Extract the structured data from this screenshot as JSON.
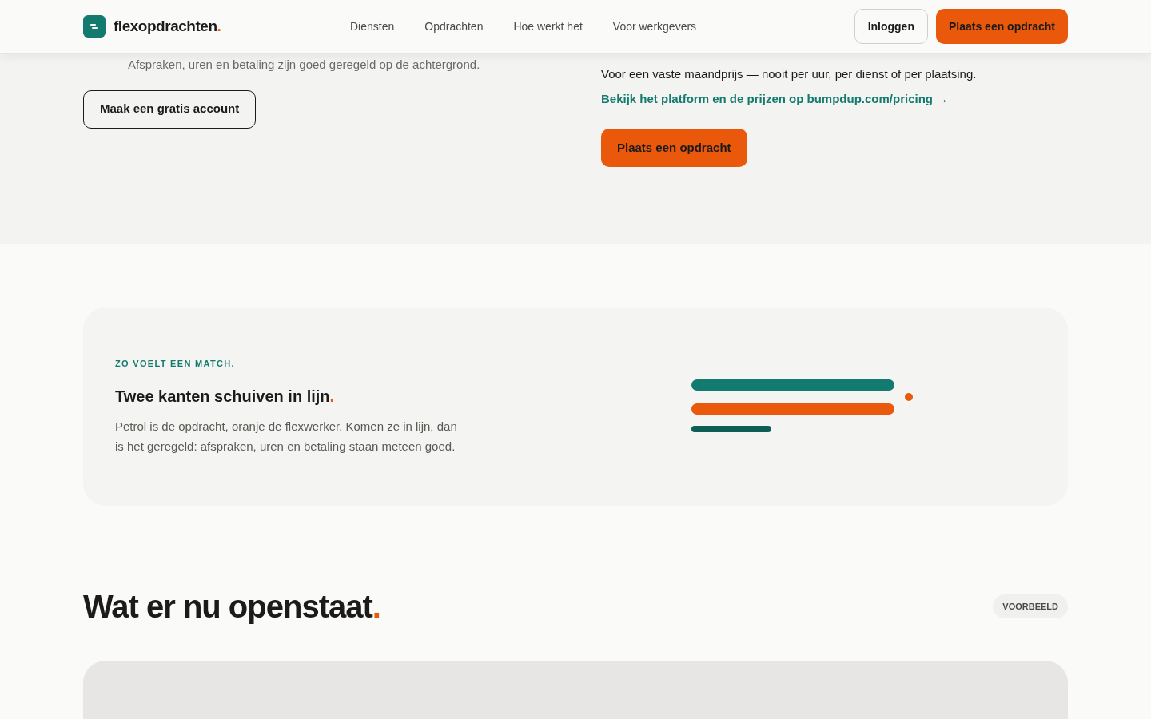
{
  "header": {
    "logo": "flexopdrachten",
    "logo_dot": ".",
    "nav": [
      "Diensten",
      "Opdrachten",
      "Hoe werkt het",
      "Voor werkgevers"
    ],
    "login": "Inloggen",
    "cta": "Plaats een opdracht"
  },
  "intro": {
    "step_text": "Afspraken, uren en betaling zijn goed geregeld op de achtergrond.",
    "account_button": "Maak een gratis account",
    "price_text": "Voor een vaste maandprijs — nooit per uur, per dienst of per plaatsing.",
    "pricing_link": "Bekijk het platform en de prijzen op bumpdup.com/pricing →",
    "cta": "Plaats een opdracht"
  },
  "match": {
    "eyebrow": "ZO VOELT EEN MATCH.",
    "title": "Twee kanten schuiven in lijn",
    "title_dot": ".",
    "body": "Petrol is de opdracht, oranje de flexwerker. Komen ze in lijn, dan is het geregeld: afspraken, uren en betaling staan meteen goed."
  },
  "open": {
    "title": "Wat er nu openstaat",
    "title_dot": ".",
    "badge": "VOORBEELD"
  }
}
